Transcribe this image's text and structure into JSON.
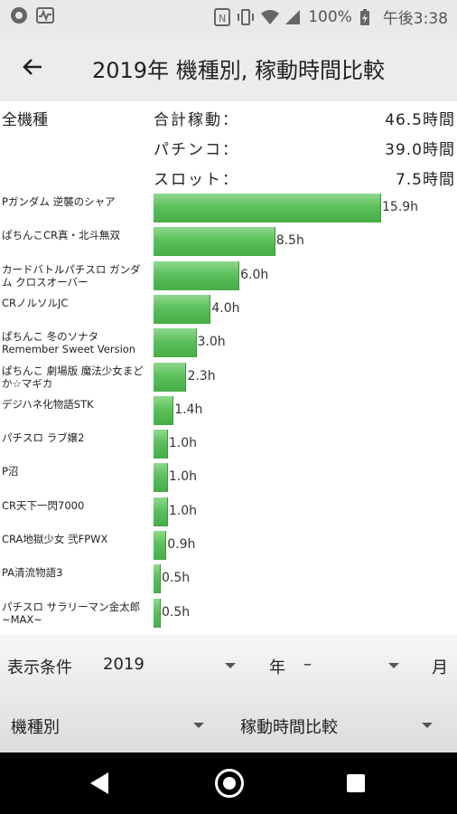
{
  "status_bar": {
    "battery": "100%",
    "time": "午後3:38"
  },
  "app_bar": {
    "back_icon": "arrow-back-icon",
    "title": "2019年 機種別, 稼動時間比較"
  },
  "summary": {
    "all_label": "全機種",
    "rows": [
      {
        "label": "合計稼動：",
        "value": "46.5時間"
      },
      {
        "label": "パチンコ：",
        "value": "39.0時間"
      },
      {
        "label": "スロット：",
        "value": "7.5時間"
      }
    ]
  },
  "chart_data": {
    "type": "bar",
    "orientation": "horizontal",
    "unit": "h",
    "categories": [
      "Pガンダム 逆襲のシャア",
      "ぱちんこCR真・北斗無双",
      "カードバトルパチスロ ガンダム クロスオーバー",
      "CRノルソルJC",
      "ぱちんこ 冬のソナタ Remember Sweet Version",
      "ぱちんこ 劇場版 魔法少女まどか☆マギカ",
      "デジハネ化物語STK",
      "パチスロ ラブ嬢2",
      "P沼",
      "CR天下一閃7000",
      "CRA地獄少女 弐FPWX",
      "PA清流物語3",
      "パチスロ サラリーマン金太郎 ~MAX~"
    ],
    "values": [
      15.9,
      8.5,
      6.0,
      4.0,
      3.0,
      2.3,
      1.4,
      1.0,
      1.0,
      1.0,
      0.9,
      0.5,
      0.5
    ],
    "value_labels": [
      "15.9h",
      "8.5h",
      "6.0h",
      "4.0h",
      "3.0h",
      "2.3h",
      "1.4h",
      "1.0h",
      "1.0h",
      "1.0h",
      "0.9h",
      "0.5h",
      "0.5h"
    ],
    "bar_color": "#5cc05c"
  },
  "conditions": {
    "label": "表示条件",
    "year_value": "2019",
    "year_unit": "年",
    "month_value": "–",
    "month_unit": "月",
    "category_select": "機種別",
    "metric_select": "稼動時間比較"
  },
  "nav": {
    "back_icon": "nav-back-icon",
    "home_icon": "nav-home-icon",
    "recents_icon": "nav-recents-icon"
  }
}
